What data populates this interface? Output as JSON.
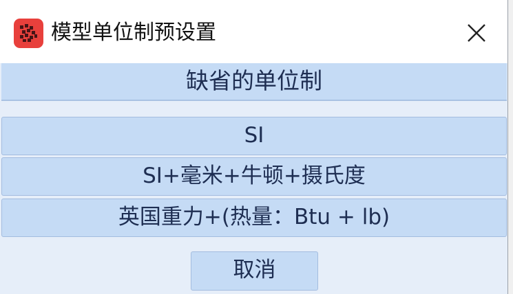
{
  "window": {
    "title": "模型单位制预设置",
    "app_icon": "app-logo-icon",
    "close_icon": "close-icon"
  },
  "header": {
    "label": "缺省的单位制"
  },
  "options": [
    {
      "label": "SI"
    },
    {
      "label": "SI+毫米+牛顿+摄氏度"
    },
    {
      "label": "英国重力+(热量：Btu + lb)"
    }
  ],
  "cancel": {
    "label": "取消"
  },
  "colors": {
    "button_bg": "#c5dbf5",
    "content_bg": "#e6eef9",
    "text": "#1e2e52",
    "app_icon_bg": "#e8403c"
  }
}
